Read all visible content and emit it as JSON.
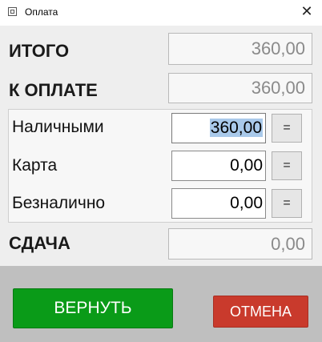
{
  "window": {
    "title": "Оплата",
    "app_icon": "app-window-icon",
    "close_icon": "close-icon",
    "close_glyph": "✕"
  },
  "totals": {
    "total_label": "ИТОГО",
    "total_value": "360,00",
    "due_label": "К ОПЛАТЕ",
    "due_value": "360,00"
  },
  "payments": [
    {
      "label": "Наличными",
      "value": "360,00",
      "selected": true,
      "eq_label": "="
    },
    {
      "label": "Карта",
      "value": "0,00",
      "selected": false,
      "eq_label": "="
    },
    {
      "label": "Безналично",
      "value": "0,00",
      "selected": false,
      "eq_label": "="
    }
  ],
  "change": {
    "label": "СДАЧА",
    "value": "0,00"
  },
  "buttons": {
    "return_label": "ВЕРНУТЬ",
    "cancel_label": "ОТМЕНА"
  },
  "colors": {
    "return_button": "#0a9b18",
    "cancel_button": "#c93a2c",
    "selection_highlight": "#a9c9ea",
    "content_background": "#eeeeee",
    "footer_background": "#bfbfbf"
  }
}
